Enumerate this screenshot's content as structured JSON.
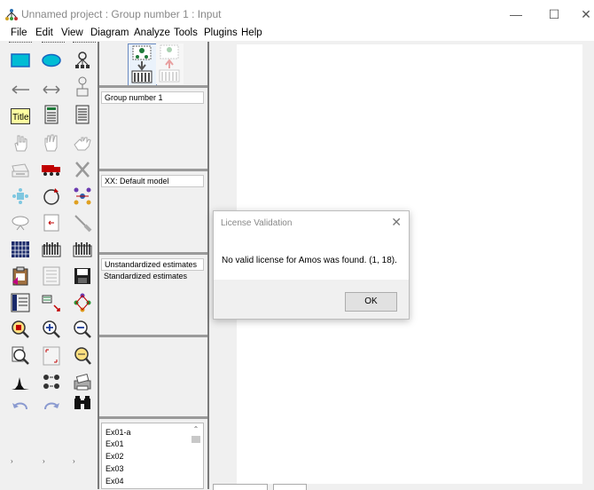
{
  "window": {
    "title": "Unnamed project : Group number 1 : Input",
    "minimize": "—",
    "maximize": "☐",
    "close": "✕"
  },
  "menu": [
    "File",
    "Edit",
    "View",
    "Diagram",
    "Analyze",
    "Tools",
    "Plugins",
    "Help"
  ],
  "panels": {
    "groups_header": "Group number 1",
    "models_header": "XX: Default model",
    "estimates": [
      "Unstandardized estimates",
      "Standardized estimates"
    ],
    "files": [
      "Ex01-a",
      "Ex01",
      "Ex02",
      "Ex03",
      "Ex04"
    ]
  },
  "dialog": {
    "title": "License Validation",
    "message": "No valid license for Amos was found. (1, 18).",
    "ok_label": "OK",
    "close": "✕"
  }
}
